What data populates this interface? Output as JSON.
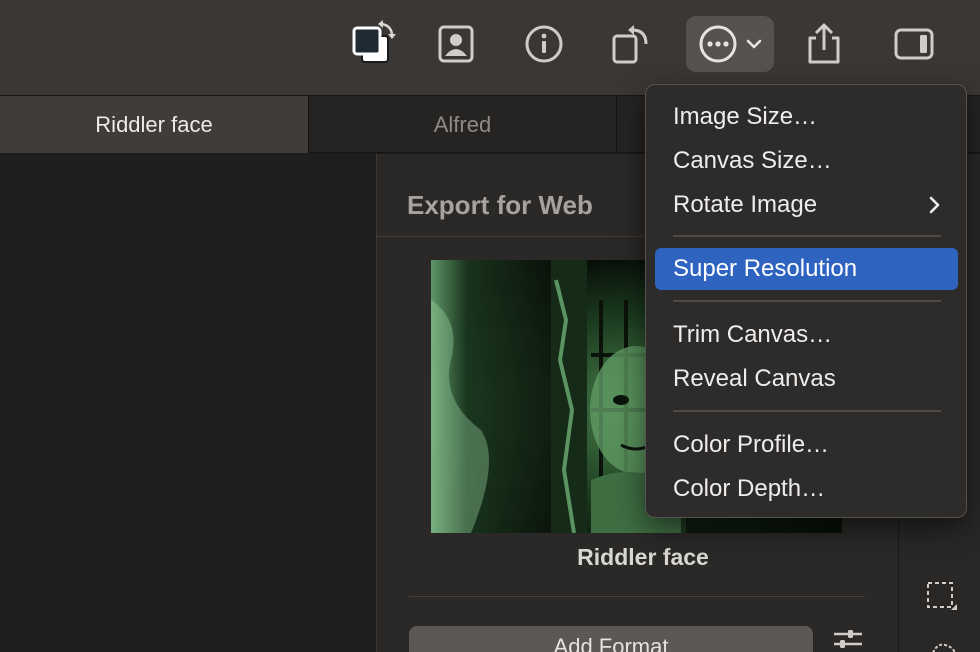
{
  "toolbar": {
    "icons": [
      "swap-colors-icon",
      "portrait-icon",
      "info-icon",
      "rotate-icon",
      "more-icon",
      "chevron-down-icon",
      "share-icon",
      "sidebar-icon"
    ]
  },
  "tabs": [
    {
      "label": "Riddler face",
      "selected": true
    },
    {
      "label": "Alfred",
      "selected": false
    }
  ],
  "panel": {
    "title": "Export for Web",
    "image_name": "Riddler face",
    "add_format_label": "Add Format"
  },
  "menu": {
    "items": [
      {
        "label": "Image Size…"
      },
      {
        "label": "Canvas Size…"
      },
      {
        "label": "Rotate Image",
        "submenu": true
      },
      {
        "label": "Super Resolution",
        "highlighted": true
      },
      {
        "label": "Trim Canvas…"
      },
      {
        "label": "Reveal Canvas"
      },
      {
        "label": "Color Profile…"
      },
      {
        "label": "Color Depth…"
      }
    ]
  },
  "colors": {
    "toolbar_bg": "#3a3735",
    "highlight": "#2f63c0",
    "panel_bg": "#2b2927",
    "canvas_bg": "#1e1e1e"
  }
}
